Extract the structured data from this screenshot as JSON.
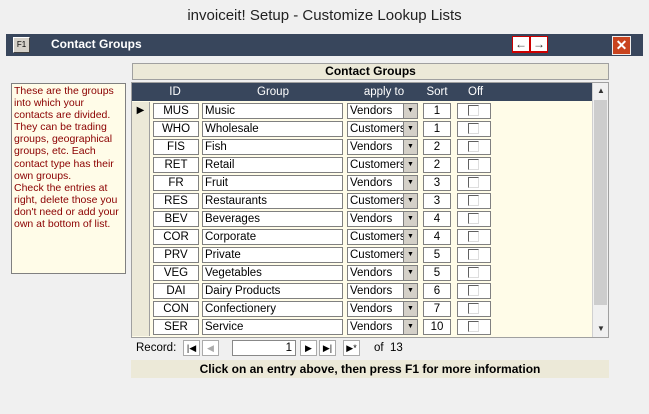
{
  "window": {
    "title": "invoiceit! Setup - Customize Lookup Lists"
  },
  "header": {
    "f1_label": "F1",
    "title": "Contact Groups",
    "prev_icon": "←",
    "next_icon": "→",
    "close_icon": "✕"
  },
  "description": "These are the groups into which your contacts are divided. They can be trading groups, geographical groups, etc. Each contact type has their own groups.\nCheck the entries at right, delete those you don't need or add your own at bottom of list.",
  "section_title": "Contact Groups",
  "columns": {
    "id": "ID",
    "group": "Group",
    "apply": "apply to",
    "sort": "Sort",
    "off": "Off"
  },
  "rows": [
    {
      "id": "MUS",
      "group": "Music",
      "apply": "Vendors",
      "sort": "1",
      "off": false
    },
    {
      "id": "WHO",
      "group": "Wholesale",
      "apply": "Customers",
      "sort": "1",
      "off": false
    },
    {
      "id": "FIS",
      "group": "Fish",
      "apply": "Vendors",
      "sort": "2",
      "off": false
    },
    {
      "id": "RET",
      "group": "Retail",
      "apply": "Customers",
      "sort": "2",
      "off": false
    },
    {
      "id": "FR",
      "group": "Fruit",
      "apply": "Vendors",
      "sort": "3",
      "off": false
    },
    {
      "id": "RES",
      "group": "Restaurants",
      "apply": "Customers",
      "sort": "3",
      "off": false
    },
    {
      "id": "BEV",
      "group": "Beverages",
      "apply": "Vendors",
      "sort": "4",
      "off": false
    },
    {
      "id": "COR",
      "group": "Corporate",
      "apply": "Customers",
      "sort": "4",
      "off": false
    },
    {
      "id": "PRV",
      "group": "Private",
      "apply": "Customers",
      "sort": "5",
      "off": false
    },
    {
      "id": "VEG",
      "group": "Vegetables",
      "apply": "Vendors",
      "sort": "5",
      "off": false
    },
    {
      "id": "DAI",
      "group": "Dairy Products",
      "apply": "Vendors",
      "sort": "6",
      "off": false
    },
    {
      "id": "CON",
      "group": "Confectionery",
      "apply": "Vendors",
      "sort": "7",
      "off": false
    },
    {
      "id": "SER",
      "group": "Service",
      "apply": "Vendors",
      "sort": "10",
      "off": false
    }
  ],
  "current_row_marker": "▶",
  "scroll": {
    "up_icon": "▲",
    "down_icon": "▼"
  },
  "navigator": {
    "label": "Record:",
    "current": "1",
    "of_label": "of",
    "total": "13",
    "first_icon": "|◀",
    "prev_icon": "◀",
    "next_icon": "▶",
    "last_icon": "▶|",
    "new_icon": "▶*"
  },
  "footer": "Click on an entry above, then press F1 for more information"
}
